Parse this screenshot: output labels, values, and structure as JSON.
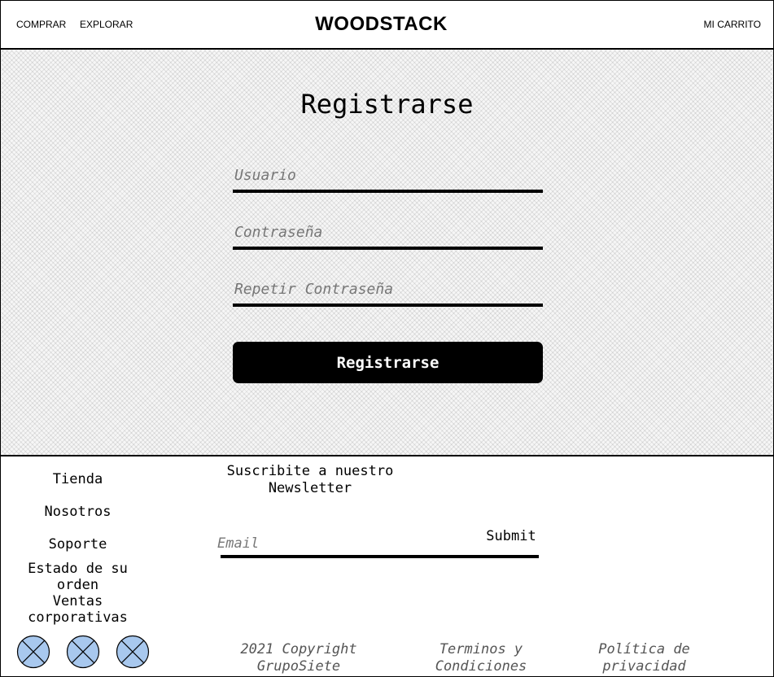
{
  "header": {
    "nav_left": [
      "COMPRAR",
      "EXPLORAR"
    ],
    "brand": "WOODSTACK",
    "cart": "MI CARRITO"
  },
  "register": {
    "title": "Registrarse",
    "username_placeholder": "Usuario",
    "password_placeholder": "Contraseña",
    "repeat_password_placeholder": "Repetir Contraseña",
    "submit_label": "Registrarse"
  },
  "footer": {
    "links": [
      "Tienda",
      "Nosotros",
      "Soporte",
      "Estado de su orden",
      "Ventas corporativas"
    ],
    "newsletter_title": "Suscribite a nuestro Newsletter",
    "email_placeholder": "Email",
    "submit_label": "Submit",
    "social_icons": [
      "social-icon-1",
      "social-icon-2",
      "social-icon-3"
    ],
    "social_color": "#a8c8ee",
    "copyright": "2021 Copyright GrupoSiete",
    "terms": "Terminos y Condiciones",
    "privacy": "Política de privacidad"
  }
}
